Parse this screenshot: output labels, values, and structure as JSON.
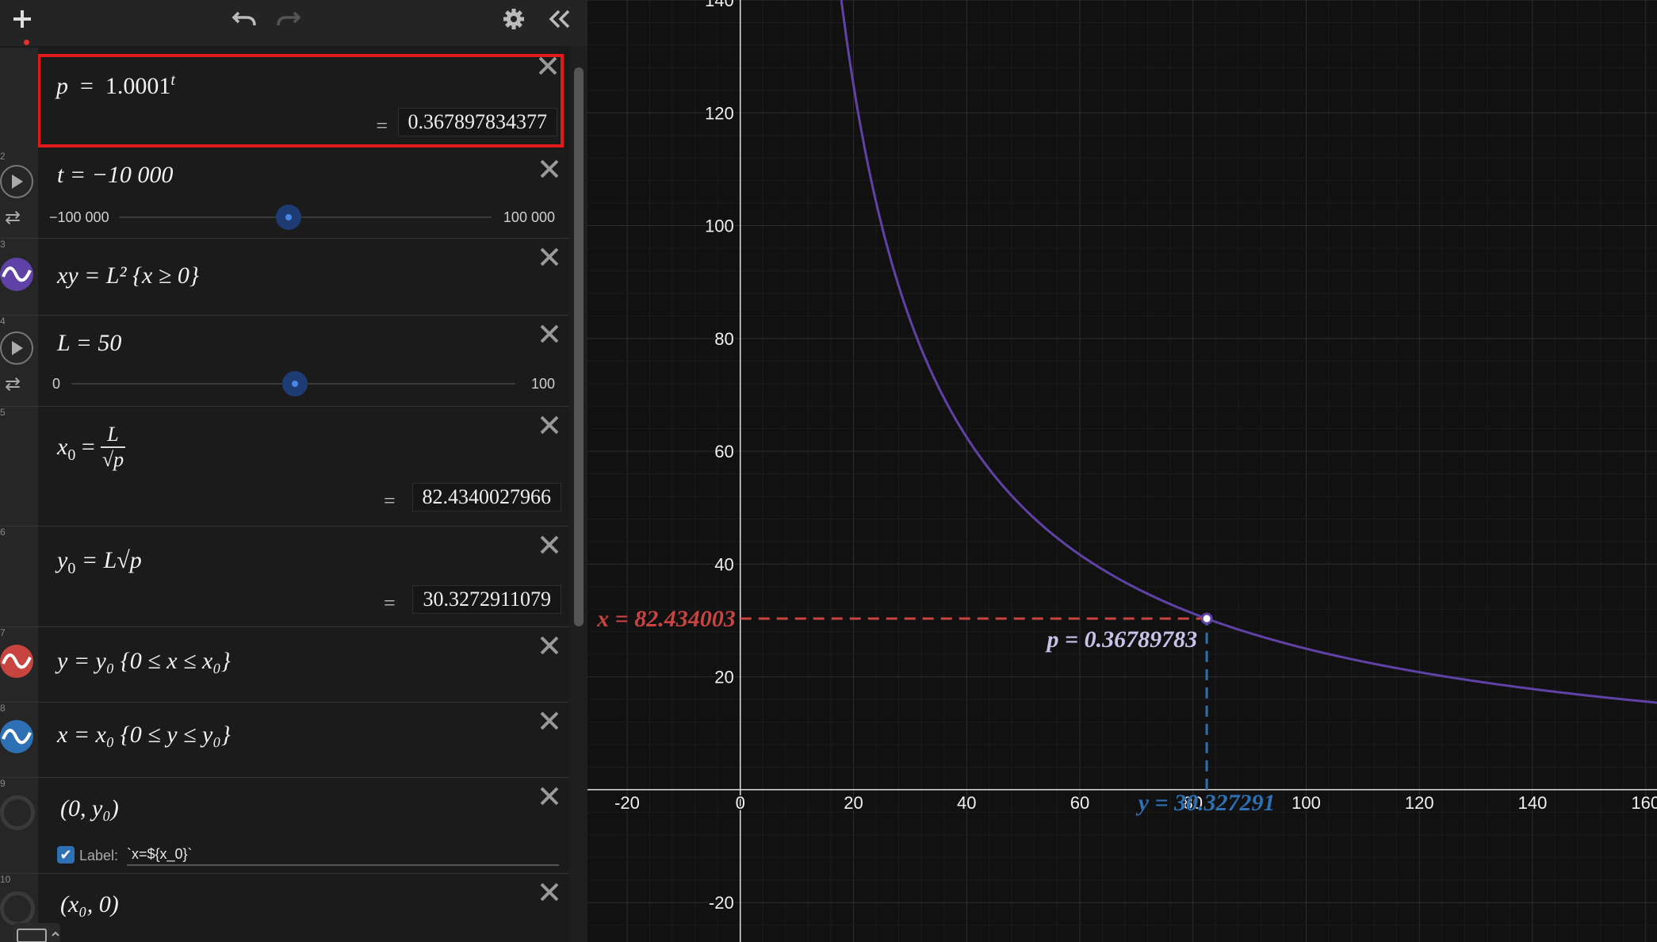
{
  "toolbar": {
    "icons": [
      "plus-icon",
      "undo-icon",
      "redo-icon",
      "gear-icon",
      "collapse-icon"
    ]
  },
  "expressions": [
    {
      "num": "",
      "latex_parts": [
        "p",
        "=",
        "1.0001",
        "t"
      ],
      "result": "0.367897834377"
    },
    {
      "num": "2",
      "text": "t = −10 000",
      "slider": {
        "min": "−100 000",
        "max": "100 000",
        "value_fraction": 0.45
      }
    },
    {
      "num": "3",
      "text": "xy = L² {x ≥ 0}",
      "color": "#6042a6"
    },
    {
      "num": "4",
      "text": "L = 50",
      "slider": {
        "min": "0",
        "max": "100",
        "value_fraction": 0.5
      }
    },
    {
      "num": "5",
      "text_lhs": "x",
      "sub": "0",
      "frac_num": "L",
      "frac_den": "√p",
      "result": "82.4340027966"
    },
    {
      "num": "6",
      "text_lhs": "y",
      "sub": "0",
      "rhs": "= L√p",
      "result": "30.3272911079"
    },
    {
      "num": "7",
      "text": "y = y₀ {0 ≤ x ≤ x₀}",
      "color": "#c74440"
    },
    {
      "num": "8",
      "text": "x = x₀ {0 ≤ y ≤ y₀}",
      "color": "#2d70b3"
    },
    {
      "num": "9",
      "text": "(0, y₀)",
      "label_checkbox": "Label:",
      "label_value": "`x=${x_0}`"
    },
    {
      "num": "10",
      "text": "(x₀, 0)"
    }
  ],
  "graph": {
    "x_ticks": [
      "-20",
      "0",
      "20",
      "40",
      "60",
      "80",
      "100",
      "120",
      "140",
      "160"
    ],
    "y_ticks": [
      "140",
      "120",
      "100",
      "80",
      "60",
      "40",
      "20",
      "-20"
    ],
    "x_range": [
      -27,
      162
    ],
    "y_range": [
      -27,
      140
    ],
    "curve_color": "#6042a6",
    "red_color": "#c74440",
    "blue_color": "#2d70b3",
    "L": 50,
    "x0": 82.4340027966,
    "y0": 30.3272911079,
    "labels": {
      "x_label": "x = 82.434003",
      "p_label": "p = 0.36789783",
      "y_label": "y = 30.327291"
    }
  }
}
